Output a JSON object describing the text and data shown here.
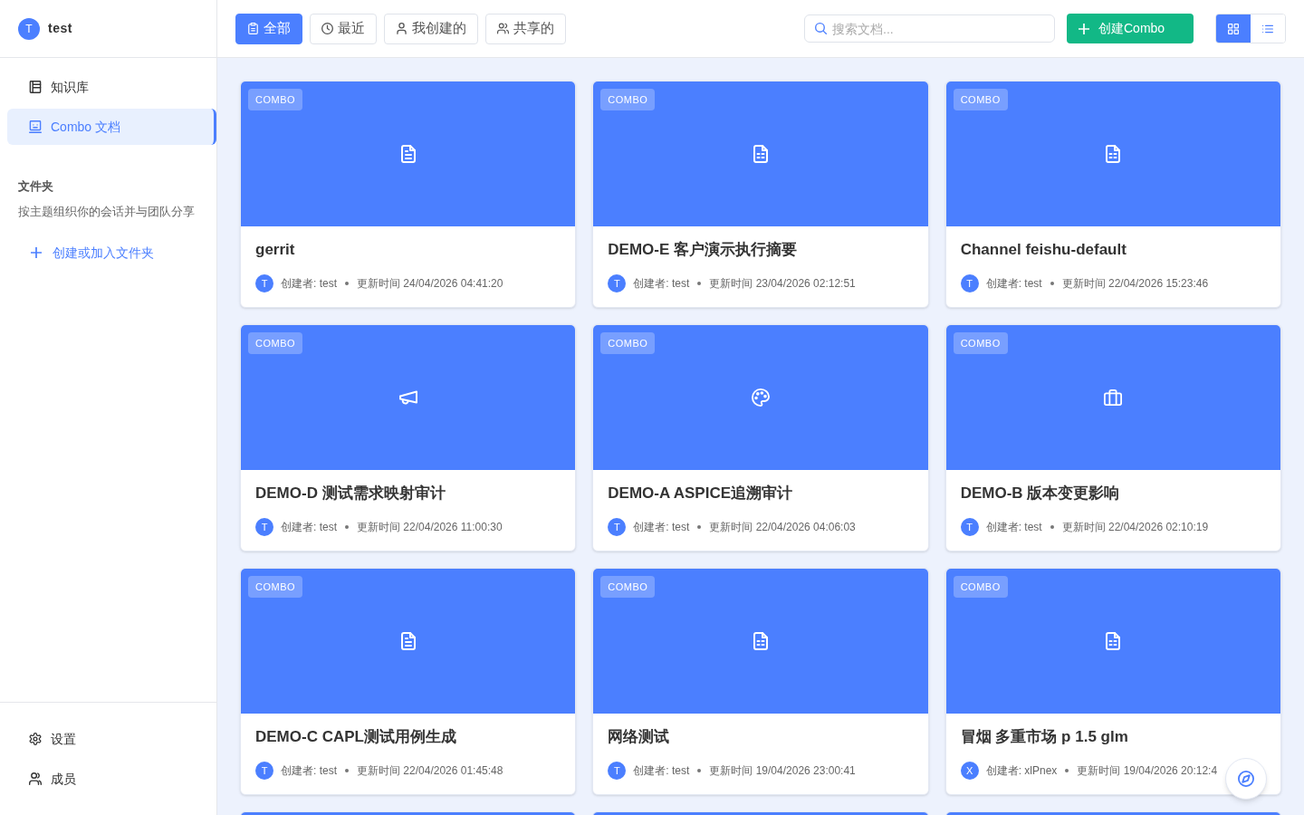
{
  "workspace": {
    "avatar": "T",
    "name": "test"
  },
  "nav": [
    {
      "kind": "library",
      "label": "知识库",
      "selected": false
    },
    {
      "kind": "combo",
      "label": "Combo 文档",
      "selected": true
    }
  ],
  "folders": {
    "title": "文件夹",
    "description": "按主题组织你的会话并与团队分享",
    "action": "创建或加入文件夹"
  },
  "footer_nav": [
    {
      "kind": "settings",
      "label": "设置"
    },
    {
      "kind": "members",
      "label": "成员"
    }
  ],
  "filters": [
    {
      "kind": "all",
      "label": "全部",
      "selected": true
    },
    {
      "kind": "recent",
      "label": "最近",
      "selected": false
    },
    {
      "kind": "mine",
      "label": "我创建的",
      "selected": false
    },
    {
      "kind": "shared",
      "label": "共享的",
      "selected": false
    }
  ],
  "search": {
    "placeholder": "搜索文档..."
  },
  "create_button": "创建Combo",
  "view_toggle": [
    {
      "kind": "grid",
      "selected": true
    },
    {
      "kind": "list",
      "selected": false
    }
  ],
  "cards": [
    {
      "kind": "doc",
      "badge": "COMBO",
      "title": "gerrit",
      "avatar": "T",
      "creator": "创建者: test",
      "updated": "更新时间 24/04/2026 04:41:20"
    },
    {
      "kind": "sheet",
      "badge": "COMBO",
      "title": "DEMO-E 客户演示执行摘要",
      "avatar": "T",
      "creator": "创建者: test",
      "updated": "更新时间 23/04/2026 02:12:51"
    },
    {
      "kind": "sheet",
      "badge": "COMBO",
      "title": "Channel feishu-default",
      "avatar": "T",
      "creator": "创建者: test",
      "updated": "更新时间 22/04/2026 15:23:46"
    },
    {
      "kind": "megaphone",
      "badge": "COMBO",
      "title": "DEMO-D 测试需求映射审计",
      "avatar": "T",
      "creator": "创建者: test",
      "updated": "更新时间 22/04/2026 11:00:30"
    },
    {
      "kind": "palette",
      "badge": "COMBO",
      "title": "DEMO-A ASPICE追溯审计",
      "avatar": "T",
      "creator": "创建者: test",
      "updated": "更新时间 22/04/2026 04:06:03"
    },
    {
      "kind": "briefcase",
      "badge": "COMBO",
      "title": "DEMO-B 版本变更影响",
      "avatar": "T",
      "creator": "创建者: test",
      "updated": "更新时间 22/04/2026 02:10:19"
    },
    {
      "kind": "doc",
      "badge": "COMBO",
      "title": "DEMO-C CAPL测试用例生成",
      "avatar": "T",
      "creator": "创建者: test",
      "updated": "更新时间 22/04/2026 01:45:48"
    },
    {
      "kind": "sheet",
      "badge": "COMBO",
      "title": "网络测试",
      "avatar": "T",
      "creator": "创建者: test",
      "updated": "更新时间 19/04/2026 23:00:41"
    },
    {
      "kind": "sheet",
      "badge": "COMBO",
      "title": "冒烟 多重市场 p 1.5 glm",
      "avatar": "X",
      "creator": "创建者: xlPnex",
      "updated": "更新时间 19/04/2026 20:12:4"
    }
  ],
  "partial_cards": [
    {
      "kind": "cover"
    },
    {
      "kind": "cover"
    },
    {
      "kind": "cover"
    }
  ]
}
